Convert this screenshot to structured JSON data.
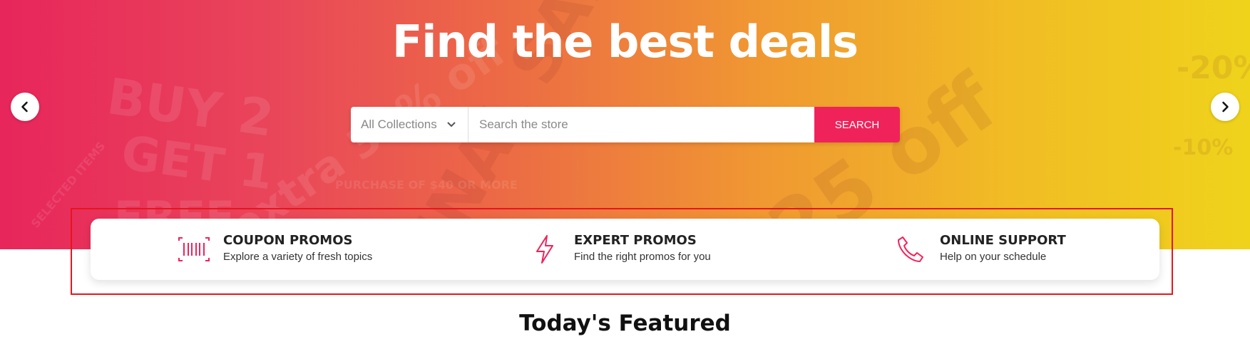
{
  "hero": {
    "title": "Find the best deals",
    "background_words": [
      "BUY 2",
      "GET 1",
      "FREE",
      "extra 30% off",
      "FINAL SALE",
      "25 off",
      "-20%",
      "-10%",
      "PURCHASE OF $40 OR MORE",
      "SELECTED ITEMS"
    ]
  },
  "search": {
    "collections_label": "All Collections",
    "placeholder": "Search the store",
    "button_label": "SEARCH"
  },
  "carousel": {
    "prev_icon": "chevron-left-icon",
    "next_icon": "chevron-right-icon"
  },
  "features": [
    {
      "icon": "barcode-icon",
      "title": "COUPON PROMOS",
      "subtitle": "Explore a variety of fresh topics"
    },
    {
      "icon": "lightning-icon",
      "title": "EXPERT PROMOS",
      "subtitle": "Find the right promos for you"
    },
    {
      "icon": "phone-icon",
      "title": "ONLINE SUPPORT",
      "subtitle": "Help on your schedule"
    }
  ],
  "featured": {
    "title": "Today's Featured"
  },
  "colors": {
    "accent": "#f0225a",
    "highlight_outline": "#e8151e"
  }
}
